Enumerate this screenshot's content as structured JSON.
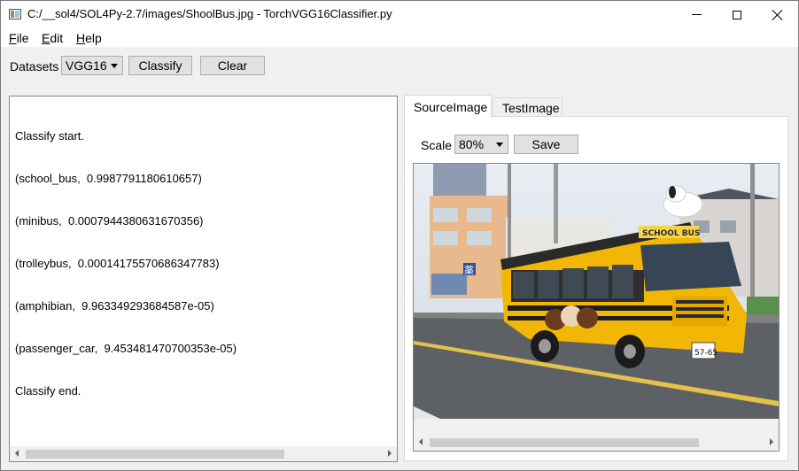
{
  "window": {
    "title": "C:/__sol4/SOL4Py-2.7/images/ShoolBus.jpg - TorchVGG16Classifier.py"
  },
  "menu": {
    "file": {
      "accel": "F",
      "rest": "ile"
    },
    "edit": {
      "accel": "E",
      "rest": "dit"
    },
    "help": {
      "accel": "H",
      "rest": "elp"
    }
  },
  "toolbar": {
    "datasets_label": "Datasets",
    "datasets_value": "VGG16",
    "classify_label": "Classify",
    "clear_label": "Clear"
  },
  "output": {
    "lines": [
      "Classify start.",
      "(school_bus,  0.9987791180610657)",
      "(minibus,  0.0007944380631670356)",
      "(trolleybus,  0.00014175570686347783)",
      "(amphibian,  9.963349293684587e-05)",
      "(passenger_car,  9.453481470700353e-05)",
      "Classify end."
    ]
  },
  "tabs": {
    "source": "SourceImage",
    "test": "TestImage"
  },
  "image_panel": {
    "scale_label": "Scale",
    "scale_value": "80%",
    "save_label": "Save",
    "photo_text": {
      "bus_sign": "SCHOOL BUS",
      "plate": "57-65",
      "shop_sign": "薬"
    }
  },
  "colors": {
    "bus_yellow": "#f2b705",
    "sky": "#dfe6ee",
    "road": "#585a5e",
    "chrome": "#f0f0f0"
  }
}
